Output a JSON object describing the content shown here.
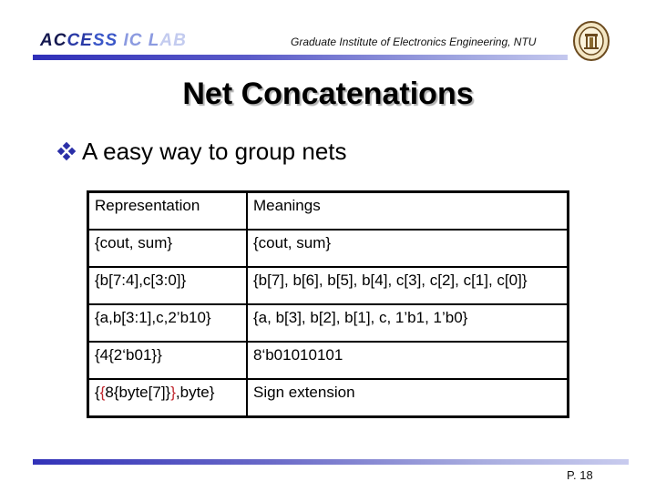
{
  "header": {
    "lab_name_parts": [
      "AC",
      "CE",
      "SS ",
      "IC L",
      "AB"
    ],
    "institute": "Graduate Institute of Electronics Engineering, NTU",
    "logo": "ntu-seal-icon",
    "accent_color": "#2f2fb8"
  },
  "slide": {
    "title": "Net Concatenations",
    "bullet_icon": "diamond-bullet-icon",
    "bullet_text": "A easy way to group nets"
  },
  "table": {
    "headers": [
      "Representation",
      "Meanings"
    ],
    "rows": [
      {
        "representation": "{cout, sum}",
        "meaning": "{cout, sum}"
      },
      {
        "representation": "{b[7:4],c[3:0]}",
        "meaning": "{b[7], b[6], b[5], b[4], c[3], c[2], c[1], c[0]}"
      },
      {
        "representation": "{a,b[3:1],c,2’b10}",
        "meaning": "{a, b[3], b[2], b[1], c, 1’b1, 1’b0}"
      },
      {
        "representation": "{4{2‘b01}}",
        "meaning": "8‘b01010101"
      },
      {
        "representation_parts": [
          "{",
          "{",
          "8{byte[7]}",
          "}",
          ",byte}"
        ],
        "meaning": "Sign extension"
      }
    ],
    "highlight_color": "#c0262d"
  },
  "footer": {
    "page": "P. 18"
  }
}
